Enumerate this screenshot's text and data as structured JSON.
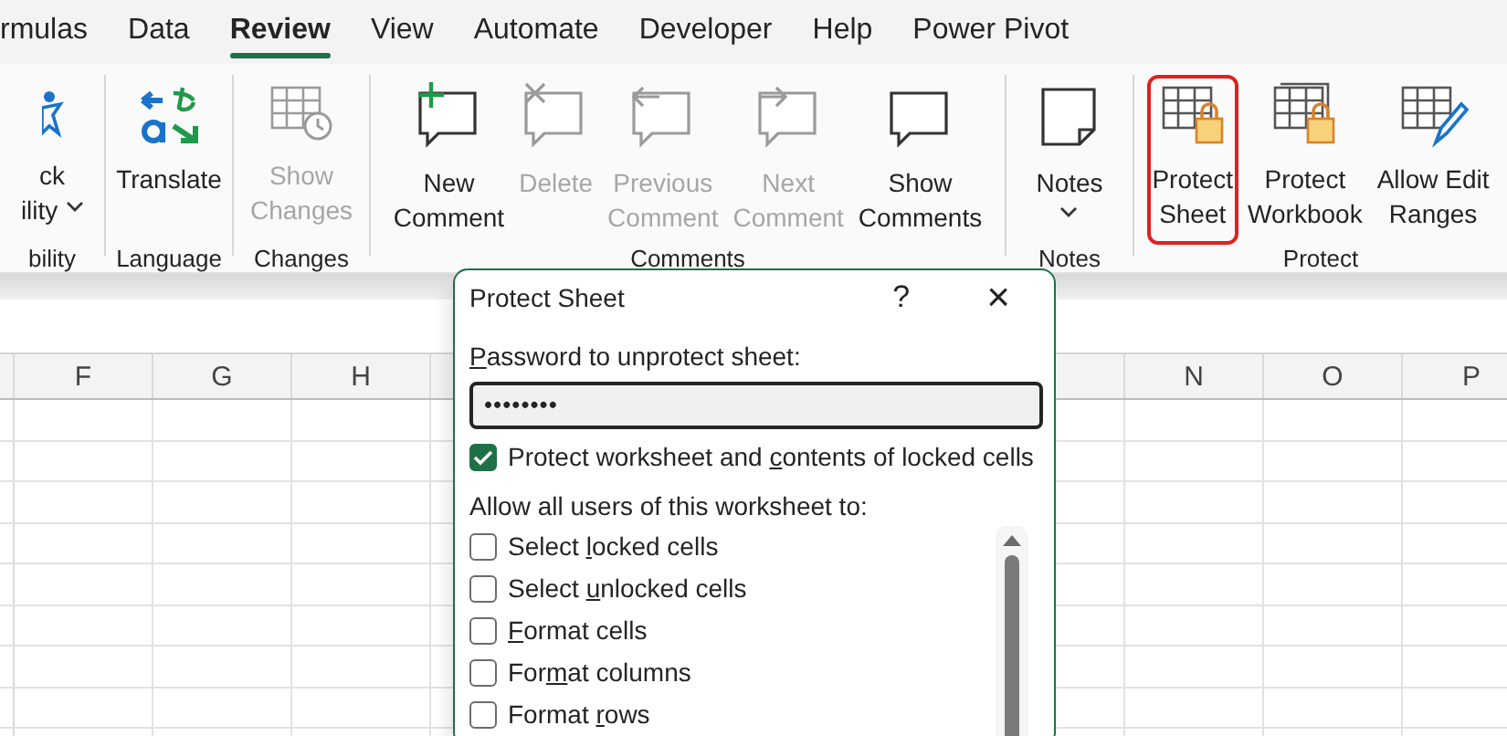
{
  "tabs": [
    {
      "label": "rmulas",
      "selected": false
    },
    {
      "label": "Data",
      "selected": false
    },
    {
      "label": "Review",
      "selected": true
    },
    {
      "label": "View",
      "selected": false
    },
    {
      "label": "Automate",
      "selected": false
    },
    {
      "label": "Developer",
      "selected": false
    },
    {
      "label": "Help",
      "selected": false
    },
    {
      "label": "Power Pivot",
      "selected": false
    }
  ],
  "ribbon_groups": [
    {
      "label": "bility",
      "buttons": [
        {
          "lines": [
            "ck",
            "ility"
          ],
          "dropdown": true,
          "disabled": false,
          "highlighted": false
        }
      ]
    },
    {
      "label": "Language",
      "buttons": [
        {
          "lines": [
            "Translate"
          ],
          "dropdown": false,
          "disabled": false,
          "highlighted": false
        }
      ]
    },
    {
      "label": "Changes",
      "buttons": [
        {
          "lines": [
            "Show",
            "Changes"
          ],
          "dropdown": false,
          "disabled": true,
          "highlighted": false
        }
      ]
    },
    {
      "label": "Comments",
      "buttons": [
        {
          "lines": [
            "New",
            "Comment"
          ],
          "dropdown": false,
          "disabled": false,
          "highlighted": false
        },
        {
          "lines": [
            "Delete"
          ],
          "dropdown": false,
          "disabled": true,
          "highlighted": false
        },
        {
          "lines": [
            "Previous",
            "Comment"
          ],
          "dropdown": false,
          "disabled": true,
          "highlighted": false
        },
        {
          "lines": [
            "Next",
            "Comment"
          ],
          "dropdown": false,
          "disabled": true,
          "highlighted": false
        },
        {
          "lines": [
            "Show",
            "Comments"
          ],
          "dropdown": false,
          "disabled": false,
          "highlighted": false
        }
      ]
    },
    {
      "label": "Notes",
      "buttons": [
        {
          "lines": [
            "Notes"
          ],
          "dropdown": true,
          "disabled": false,
          "highlighted": false
        }
      ]
    },
    {
      "label": "Protect",
      "buttons": [
        {
          "lines": [
            "Protect",
            "Sheet"
          ],
          "dropdown": false,
          "disabled": false,
          "highlighted": true
        },
        {
          "lines": [
            "Protect",
            "Workbook"
          ],
          "dropdown": false,
          "disabled": false,
          "highlighted": false
        },
        {
          "lines": [
            "Allow Edit",
            "Ranges"
          ],
          "dropdown": false,
          "disabled": false,
          "highlighted": false
        }
      ]
    }
  ],
  "columns_left": [
    "F",
    "G",
    "H"
  ],
  "columns_right": [
    "N",
    "O",
    "P"
  ],
  "dialog": {
    "title": "Protect Sheet",
    "help": "?",
    "close": "×",
    "password_label": {
      "key": "P",
      "post": "assword to unprotect sheet:"
    },
    "password_value": "••••••••",
    "protect_option": {
      "pre": "Protect worksheet and ",
      "key": "c",
      "post": "ontents of locked cells",
      "checked": true
    },
    "allow_label": "Allow all users of this worksheet to:",
    "permissions": [
      {
        "pre": "Select ",
        "key": "l",
        "post": "ocked cells",
        "checked": false
      },
      {
        "pre": "Select ",
        "key": "u",
        "post": "nlocked cells",
        "checked": false
      },
      {
        "key": "F",
        "post": "ormat cells",
        "checked": false
      },
      {
        "pre": "For",
        "key": "m",
        "post": "at columns",
        "checked": false
      },
      {
        "pre": "Format ",
        "key": "r",
        "post": "ows",
        "checked": false
      }
    ]
  }
}
